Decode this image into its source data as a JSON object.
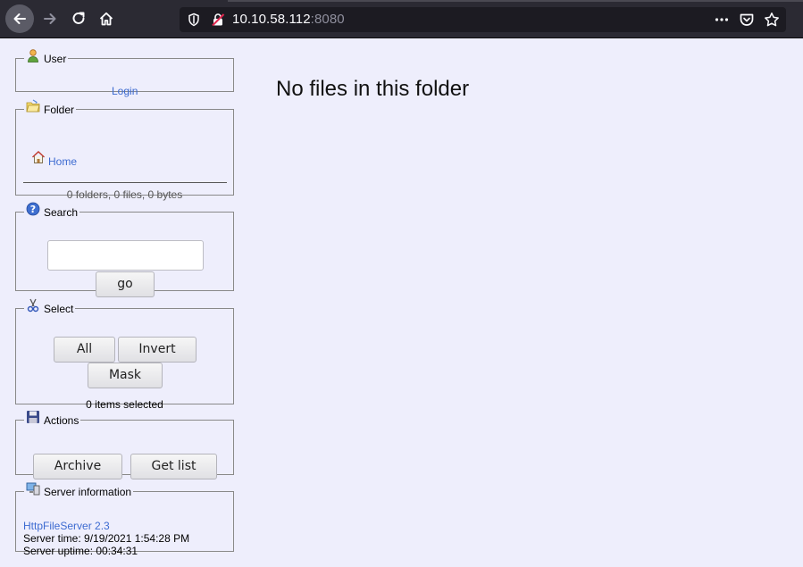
{
  "browser": {
    "url_host": "10.10.58.112",
    "url_port": ":8080"
  },
  "panels": {
    "user": {
      "legend": "User",
      "login_label": "Login"
    },
    "folder": {
      "legend": "Folder",
      "home_label": "Home",
      "stats": "0 folders, 0 files, 0 bytes"
    },
    "search": {
      "legend": "Search",
      "query": "",
      "go_label": "go"
    },
    "select": {
      "legend": "Select",
      "all_label": "All",
      "invert_label": "Invert",
      "mask_label": "Mask",
      "selected_text": "0 items selected"
    },
    "actions": {
      "legend": "Actions",
      "archive_label": "Archive",
      "getlist_label": "Get list"
    },
    "server": {
      "legend": "Server information",
      "version_link": "HttpFileServer 2.3",
      "server_time": "Server time: 9/19/2021 1:54:28 PM",
      "server_uptime": "Server uptime: 00:34:31"
    }
  },
  "main": {
    "message": "No files in this folder"
  },
  "colors": {
    "page_bg": "#eeeefc",
    "link": "#3d6bd1",
    "chrome_bg": "#2b2a33"
  },
  "icons": [
    "back-arrow-icon",
    "forward-arrow-icon",
    "reload-icon",
    "home-icon",
    "shield-icon",
    "insecure-lock-icon",
    "more-icon",
    "pocket-icon",
    "star-icon",
    "user-icon",
    "folder-icon",
    "help-icon",
    "scissors-icon",
    "floppy-disk-icon",
    "server-icon"
  ]
}
